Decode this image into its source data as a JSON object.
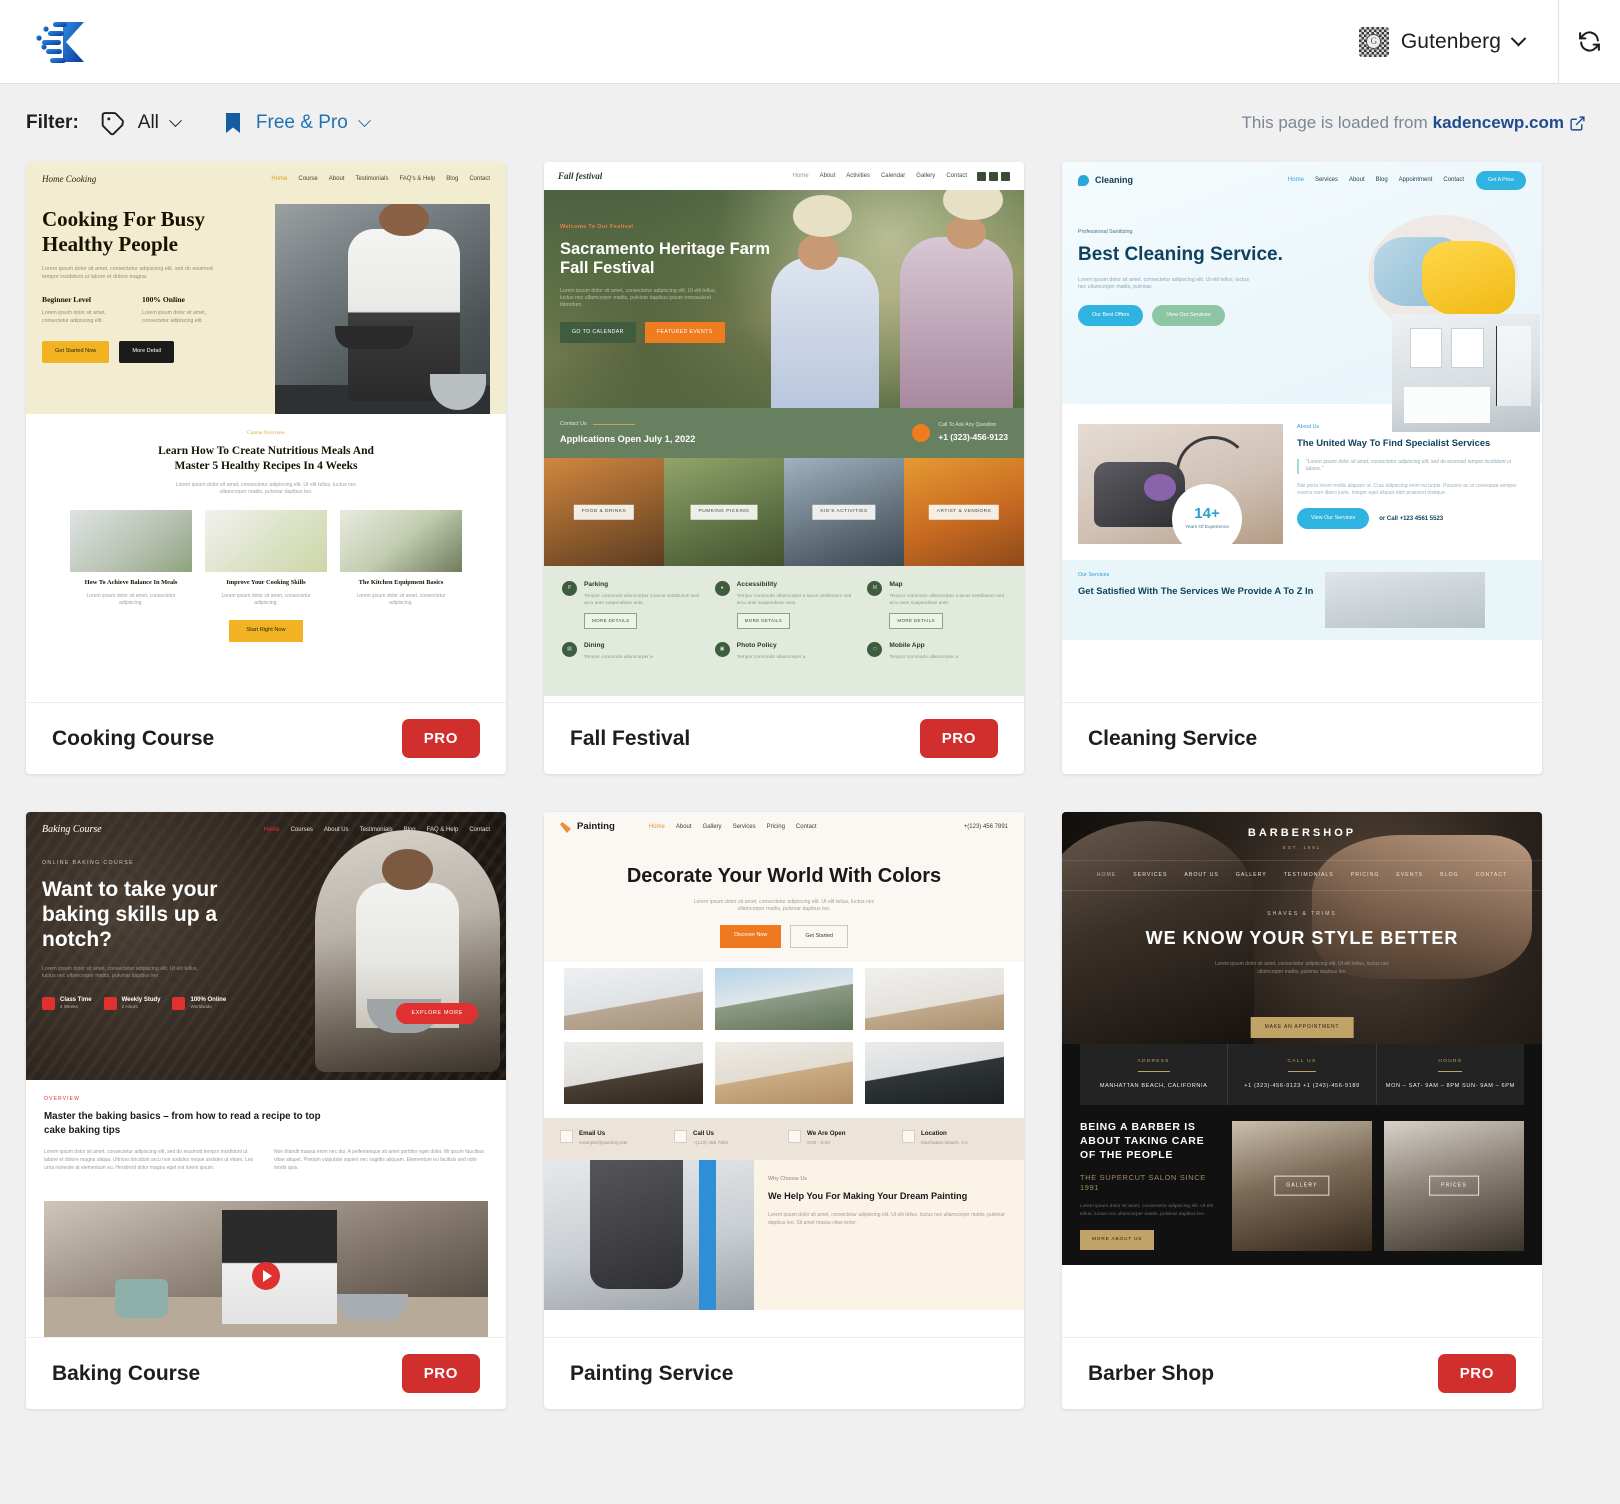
{
  "topbar": {
    "logo_icon": "kadence-logo-icon",
    "site_icon": "gutenberg-icon",
    "site_name": "Gutenberg",
    "dropdown_icon": "chevron-down-icon",
    "refresh_icon": "refresh-icon",
    "brand_color": "#1a63c8"
  },
  "filterbar": {
    "label": "Filter:",
    "tag_icon": "tag-icon",
    "category": "All",
    "bookmark_icon": "bookmark-icon",
    "plan": "Free & Pro",
    "loaded_prefix": "This page is loaded from ",
    "loaded_link": "kadencewp.com",
    "external_icon": "external-link-icon",
    "link_color": "#1f4c8f",
    "accent_color": "#2271b1"
  },
  "badges": {
    "pro": "PRO",
    "pro_color": "#d12e2e"
  },
  "templates": [
    {
      "title": "Cooking Course",
      "pro": true,
      "site": {
        "logo": "Home Cooking",
        "nav": [
          "Home",
          "Course",
          "About",
          "Testimonials",
          "FAQ's & Help",
          "Blog",
          "Contact"
        ],
        "hero_heading": "Cooking For Busy Healthy People",
        "hero_body": "Lorem ipsum dolor sit amet, consectetur adipiscing elit, sed do eiusmod tempor incididunt ut labore et dolore magna.",
        "stats": [
          {
            "title": "Beginner Level",
            "text": "Lorem ipsum dolor sit amet, consectetur adipiscing elit."
          },
          {
            "title": "100% Online",
            "text": "Lorem ipsum dolor sit amet, consectetur adipiscing elit."
          }
        ],
        "buttons": [
          "Get Started Now",
          "More Detail"
        ],
        "section_eyebrow": "Course Overview",
        "section_heading": "Learn How To Create Nutritious Meals And Master 5 Healthy Recipes In 4 Weeks",
        "section_sub": "Lorem ipsum dolor sit amet, consectetur adipiscing elit. Ut elit tellus, luctus nec ullamcorper mattis, pulvinar dapibus leo.",
        "cards": [
          {
            "title": "How To Achieve Balance In Meals",
            "text": "Lorem ipsum dolor sit amet, consectetur adipiscing."
          },
          {
            "title": "Improve Your Cooking Skills",
            "text": "Lorem ipsum dolor sit amet, consectetur adipiscing."
          },
          {
            "title": "The Kitchen Equipment Basics",
            "text": "Lorem ipsum dolor sit amet, consectetur adipiscing."
          }
        ],
        "cta": "Start Right Now"
      }
    },
    {
      "title": "Fall Festival",
      "pro": true,
      "site": {
        "logo": "Fall festival",
        "nav": [
          "Home",
          "About",
          "Activities",
          "Calendar",
          "Gallery",
          "Contact"
        ],
        "eyebrow": "Welcome To Our Festival",
        "hero_heading": "Sacramento Heritage Farm Fall Festival",
        "hero_body": "Lorem ipsum dolor sit amet, consectetur adipiscing elit. Ut elit tellus, luctus nec ullamcorper mattis, pulvinar dapibus ipsum nonsaukset bitendum.",
        "buttons": [
          "GO TO CALENDAR",
          "FEATURED EVENTS"
        ],
        "contact_label": "Contact Us",
        "applications": "Applications Open July 1, 2022",
        "phone_label": "Call To Ask Any Question",
        "phone": "+1 (323)-456-9123",
        "tiles": [
          "FOOD & DRINKS",
          "PUMKING PICKING",
          "KID'S ACTIVITIES",
          "ARTIST & VENDORS"
        ],
        "info": [
          {
            "title": "Parking",
            "text": "Tempor commodo ullamcorper a lacus vestibulum sed arcu ante suspendisse ante.",
            "btn": "MORE DETAILS"
          },
          {
            "title": "Accessibility",
            "text": "Tempor commodo ullamcorper a lacus vestibulum sed arcu ante suspendisse ante.",
            "btn": "MORE DETAILS"
          },
          {
            "title": "Map",
            "text": "Tempor commodo ullamcorper a lacus vestibulum sed arcu ante suspendisse ante.",
            "btn": "MORE DETAILS"
          },
          {
            "title": "Dining",
            "text": "Tempor commodo ullamcorper a",
            "btn": ""
          },
          {
            "title": "Photo Policy",
            "text": "Tempor commodo ullamcorper a",
            "btn": ""
          },
          {
            "title": "Mobile App",
            "text": "Tempor commodo ullamcorper a",
            "btn": ""
          }
        ]
      }
    },
    {
      "title": "Cleaning Service",
      "pro": false,
      "site": {
        "logo": "Cleaning",
        "nav": [
          "Home",
          "Services",
          "About",
          "Blog",
          "Appointment",
          "Contact"
        ],
        "header_btn": "Get A Price",
        "eyebrow": "Professional Sanitizing",
        "hero_heading": "Best Cleaning Service.",
        "hero_body": "Lorem ipsum dolor sit amet, consectetur adipiscing elit. Ut elit tellus, luctus nec ullamcorper mattis, pulvinar.",
        "buttons": [
          "Our Best Offers",
          "View Our Services"
        ],
        "badge_number": "14+",
        "badge_label": "Years Of Experience",
        "about_eyebrow": "About Us",
        "about_heading": "The United Way To Find Specialist Services",
        "about_quote": "\"Lorem ipsum dolor sit amet, consectetur adipiscing elit, sed do eiusmod tempor incididunt ut labore.\"",
        "about_body": "Nisi porta lorem mollis aliquam ut. Cras adipiscing enim eu turpis. Posuere ac ut consequat semper viverra nam libero justo. Integer eget aliquet nibh praesent tristique.",
        "about_btn": "View Our Services",
        "about_call": "or Call +123 4561 5523",
        "services_eyebrow": "Our Services",
        "services_heading": "Get Satisfied With The Services We Provide A To Z In"
      }
    },
    {
      "title": "Baking Course",
      "pro": true,
      "site": {
        "logo": "Baking Course",
        "nav": [
          "Home",
          "Courses",
          "About Us",
          "Testimonials",
          "Blog",
          "FAQ & Help",
          "Contact"
        ],
        "eyebrow": "ONLINE BAKING COURSE",
        "hero_heading": "Want to take your baking skills up a notch?",
        "hero_body": "Lorem ipsum dolor sit amet, consectetur adipiscing elit. Ut elit tellus, luctus nec ullamcorper mattis, pulvinar dapibus leo",
        "hero_btn": "EXPLORE MORE",
        "stats": [
          {
            "title": "Class Time",
            "value": "4 Weeks"
          },
          {
            "title": "Weekly Study",
            "value": "2 Hours"
          },
          {
            "title": "100% Online",
            "value": "Worldwide"
          }
        ],
        "overview_eyebrow": "OVERVIEW",
        "overview_heading": "Master the baking basics – from how to read a recipe to top cake baking tips",
        "overview_col1": "Lorem ipsum dolor sit amet, consectetur adipiscing elit, sed do eiusmod tempor incididunt ut labore et dolore magna aliqua. Ultrices tincidunt arcu non sodales neque sodales ut etiam. Leo urna molestie at elementum eu. Hendrerit dolor magna eget est lorem ipsum.",
        "overview_col2": "Non blandit massa enim nec dui. A pellentesque sit amet porttitor eget dolor. Mi ipsum faucibus vitae aliquet. Pretium vulputate sapien nec sagittis aliquam. Elementum eu facilisis sed odio morbi quis.",
        "play_icon": "play-icon"
      }
    },
    {
      "title": "Painting Service",
      "pro": false,
      "site": {
        "logo": "Painting",
        "nav": [
          "Home",
          "About",
          "Gallery",
          "Services",
          "Pricing",
          "Contact"
        ],
        "phone": "+(123) 456 7891",
        "hero_heading": "Decorate Your World With Colors",
        "hero_body": "Lorem ipsum dolor sit amet, consectetur adipiscing elit. Ut elit tellus, luctus nec ullamcorper mattis, pulvinar dapibus leo.",
        "buttons": [
          "Discover Now",
          "Get Started"
        ],
        "contact": [
          {
            "title": "Email Us",
            "value": "example@painting.site"
          },
          {
            "title": "Call Us",
            "value": "+(123) 456 7891"
          },
          {
            "title": "We Are Open",
            "value": "9:00 - 6:00"
          },
          {
            "title": "Location",
            "value": "Manhattan Beach, CA"
          }
        ],
        "why_eyebrow": "Why Choose Us",
        "why_heading": "We Help You For Making Your Dream Painting",
        "why_body": "Lorem ipsum dolor sit amet, consectetur adipiscing elit. Ut elit tellus, luctus nec ullamcorper mattis, pulvinar dapibus leo. Sit amet massa vitae tortor."
      }
    },
    {
      "title": "Barber Shop",
      "pro": true,
      "site": {
        "logo": "BARBERSHOP",
        "logo_sub": "EST. 1991",
        "nav": [
          "HOME",
          "SERVICES",
          "ABOUT US",
          "GALLERY",
          "TESTIMONIALS",
          "PRICING",
          "EVENTS",
          "BLOG",
          "CONTACT"
        ],
        "eyebrow": "SHAVES & TRIMS",
        "hero_heading": "WE KNOW YOUR STYLE BETTER",
        "hero_body": "Lorem ipsum dolor sit amet, consectetur adipiscing elit. Ut elit tellus, luctus nec ullamcorper mattis, pulvinar dapibus leo.",
        "hero_btn": "MAKE AN APPOINTMENT",
        "info": [
          {
            "head": "ADDRESS",
            "value": "MANHATTAN BEACH, CALIFORNIA"
          },
          {
            "head": "CALL US",
            "value": "+1 (323)-456-9123 +1 (243)-456-9189"
          },
          {
            "head": "HOURS",
            "value": "MON – SAT- 9AM – 8PM SUN- 9AM – 6PM"
          }
        ],
        "about_heading": "BEING A BARBER IS ABOUT TAKING CARE OF THE PEOPLE",
        "about_salon": "THE SUPERCUT SALON SINCE 1991",
        "about_body": "Lorem ipsum dolor sit amet, consectetur adipiscing elit. Ut elit tellus, luctus nec ullamcorper mattis, pulvinar dapibus leo.",
        "about_btn": "MORE ABOUT US",
        "tiles": [
          "GALLERY",
          "PRICES"
        ]
      }
    }
  ]
}
